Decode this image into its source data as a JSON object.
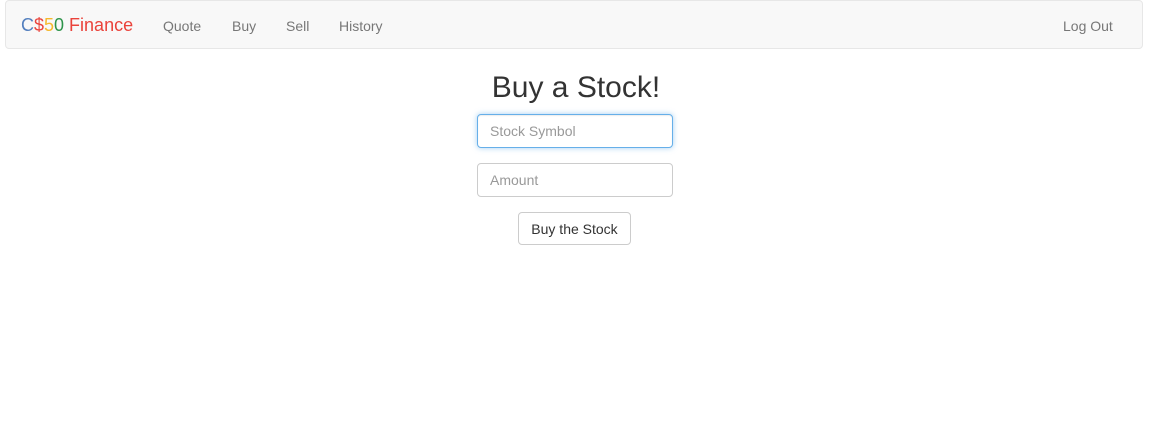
{
  "navbar": {
    "brand": {
      "parts": [
        {
          "text": "C",
          "color": "#537fbe"
        },
        {
          "text": "$",
          "color": "#ea433b"
        },
        {
          "text": "5",
          "color": "#f5b82e"
        },
        {
          "text": "0",
          "color": "#2e944b"
        },
        {
          "text": "Finance",
          "color": "#ea433b"
        }
      ]
    },
    "items": [
      {
        "label": "Quote"
      },
      {
        "label": "Buy"
      },
      {
        "label": "Sell"
      },
      {
        "label": "History"
      }
    ],
    "logout_label": "Log Out"
  },
  "main": {
    "title": "Buy a Stock!",
    "symbol_input": {
      "placeholder": "Stock Symbol",
      "value": ""
    },
    "amount_input": {
      "placeholder": "Amount",
      "value": ""
    },
    "submit_label": "Buy the Stock"
  }
}
